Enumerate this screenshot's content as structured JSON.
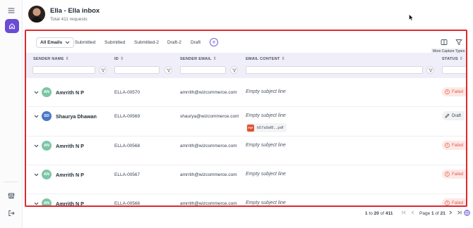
{
  "header": {
    "title": "Ella - Ella inbox",
    "subtitle": "Total 411 requests"
  },
  "toolbar": {
    "selected_view": "All Emails",
    "tabs": [
      "Submitted",
      "Submitted",
      "Submitted-2",
      "Draft-2",
      "Draft"
    ],
    "tooltip": "More Capture Types"
  },
  "table": {
    "columns": [
      "SENDER NAME",
      "ID",
      "SENDER EMAIL",
      "EMAIL CONTENT",
      "STATUS"
    ],
    "rows": [
      {
        "initials": "AN",
        "name": "Amrrith N P",
        "id": "ELLA-00570",
        "email": "amrrith@wizcommerce.com",
        "subject": "Empty subject line",
        "status": "Failed"
      },
      {
        "initials": "SD",
        "name": "Shaurya Dhawan",
        "id": "ELLA-00569",
        "email": "shaurya@wizcommerce.com",
        "subject": "Empty subject line",
        "attachment": "b57a9af8....pdf",
        "status": "Draft"
      },
      {
        "initials": "AN",
        "name": "Amrrith N P",
        "id": "ELLA-00568",
        "email": "amrrith@wizcommerce.com",
        "subject": "Empty subject line",
        "status": "Failed"
      },
      {
        "initials": "AN",
        "name": "Amrrith N P",
        "id": "ELLA-00567",
        "email": "amrrith@wizcommerce.com",
        "subject": "Empty subject line",
        "status": "Failed"
      },
      {
        "initials": "AN",
        "name": "Amrrith N P",
        "id": "ELLA-00566",
        "email": "amrrith@wizcommerce.com",
        "subject": "Empty subject line",
        "status": "Failed"
      }
    ],
    "pdf_badge": "PDF"
  },
  "pagination": {
    "range_from": "1",
    "range_sep": " to ",
    "range_to": "20",
    "of_word": " of ",
    "total": "411",
    "page_word": "Page ",
    "page": "1",
    "page_total": "21"
  },
  "colors": {
    "accent": "#6a4bd6",
    "highlight_border": "#e0282e",
    "failed": "#e25b4a",
    "header_bg": "#efeef9"
  },
  "icons": {
    "rail": [
      "menu-icon",
      "home-icon",
      "store-icon",
      "logout-icon"
    ],
    "toolbar": [
      "columns-icon",
      "filter-icon"
    ]
  }
}
